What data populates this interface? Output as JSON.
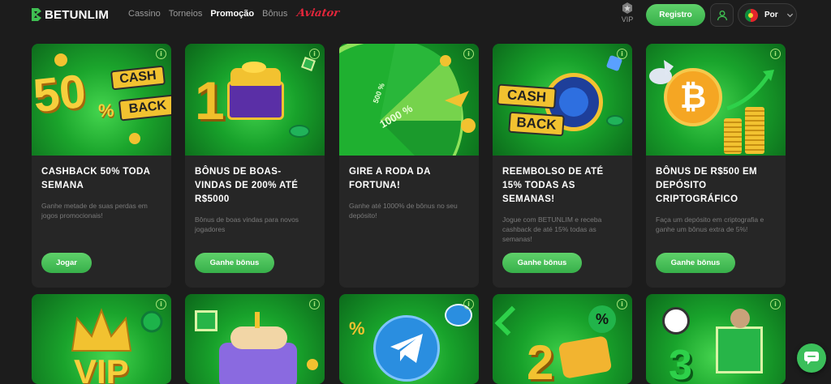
{
  "brand": {
    "name": "BETUNLIM"
  },
  "nav": [
    {
      "label": "Cassino"
    },
    {
      "label": "Torneios"
    },
    {
      "label": "Promoção",
      "active": true
    },
    {
      "label": "Bônus"
    }
  ],
  "aviator_label": "Aviator",
  "vip": {
    "label": "VIP"
  },
  "registro_label": "Registro",
  "language": {
    "selected": "Por"
  },
  "colors": {
    "accent": "#3fbf52",
    "background": "#1c1c1c",
    "card": "#262626",
    "aviator": "#e3263b"
  },
  "cards": [
    {
      "title": "CASHBACK 50% TODA SEMANA",
      "description": "Ganhe metade de suas perdas em jogos promocionais!",
      "button": "Jogar",
      "image_text": [
        "50",
        "%",
        "CASH",
        "BACK"
      ]
    },
    {
      "title": "BÔNUS DE BOAS-VINDAS DE 200% ATÉ R$5000",
      "description": "Bônus de boas vindas para novos jogadores",
      "button": "Ganhe bônus",
      "image_text": [
        "1"
      ]
    },
    {
      "title": "GIRE A RODA DA FORTUNA!",
      "description": "Ganhe até 1000% de bônus no seu depósito!",
      "button": "",
      "image_text": [
        "1000 %",
        "500 %"
      ]
    },
    {
      "title": "REEMBOLSO DE ATÉ 15% TODAS AS SEMANAS!",
      "description": "Jogue com BETUNLIM e receba cashback de até 15% todas as semanas!",
      "button": "Ganhe bônus",
      "image_text": [
        "CASH",
        "BACK"
      ]
    },
    {
      "title": "BÔNUS DE R$500 EM DEPÓSITO CRIPTOGRÁFICO",
      "description": "Faça um depósito em criptografia e ganhe um bônus extra de 5%!",
      "button": "Ganhe bônus",
      "image_text": [
        "₿"
      ]
    }
  ],
  "row2_image_text": [
    "VIP",
    "%",
    "2",
    "3"
  ],
  "icons": [
    "logo-mark-icon",
    "vip-icon",
    "user-icon",
    "flag-icon",
    "chevron-down-icon",
    "info-icon",
    "chat-icon",
    "telegram-icon"
  ]
}
